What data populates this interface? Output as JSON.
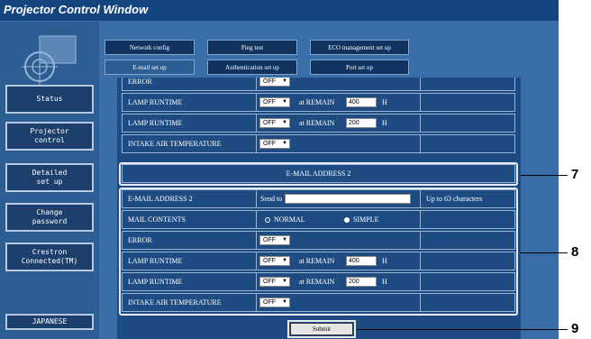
{
  "window": {
    "title": "Projector Control Window"
  },
  "sidebar": {
    "items": [
      {
        "label": "Status"
      },
      {
        "label": "Projector\ncontrol"
      },
      {
        "label": "Detailed\nset up"
      },
      {
        "label": "Change\npassword"
      },
      {
        "label": "Crestron\nConnected(TM)"
      }
    ],
    "language": "JAPANESE"
  },
  "tabs": {
    "row1": [
      "Network config",
      "Ping test",
      "ECO management set up"
    ],
    "row2": [
      "E-mail set up",
      "Authentication set up",
      "Port set up"
    ],
    "active": "E-mail set up"
  },
  "upper_rows": [
    {
      "label": "ERROR",
      "select": "OFF"
    },
    {
      "label": "LAMP RUNTIME",
      "select": "OFF",
      "remain_label": "at REMAIN",
      "remain": "400",
      "unit": "H"
    },
    {
      "label": "LAMP RUNTIME",
      "select": "OFF",
      "remain_label": "at REMAIN",
      "remain": "200",
      "unit": "H"
    },
    {
      "label": "INTAKE AIR TEMPERATURE",
      "select": "OFF"
    }
  ],
  "section2": {
    "header": "E-MAIL ADDRESS 2",
    "address_label": "E-MAIL ADDRESS 2",
    "send_to": "Send to",
    "address_value": "",
    "hint": "Up to 63 characters",
    "mail_contents_label": "MAIL CONTENTS",
    "normal": "NORMAL",
    "simple": "SIMPLE",
    "rows": [
      {
        "label": "ERROR",
        "select": "OFF"
      },
      {
        "label": "LAMP RUNTIME",
        "select": "OFF",
        "remain_label": "at REMAIN",
        "remain": "400",
        "unit": "H"
      },
      {
        "label": "LAMP RUNTIME",
        "select": "OFF",
        "remain_label": "at REMAIN",
        "remain": "200",
        "unit": "H"
      },
      {
        "label": "INTAKE AIR TEMPERATURE",
        "select": "OFF"
      }
    ]
  },
  "submit": "Submit",
  "callouts": [
    "7",
    "8",
    "9"
  ]
}
